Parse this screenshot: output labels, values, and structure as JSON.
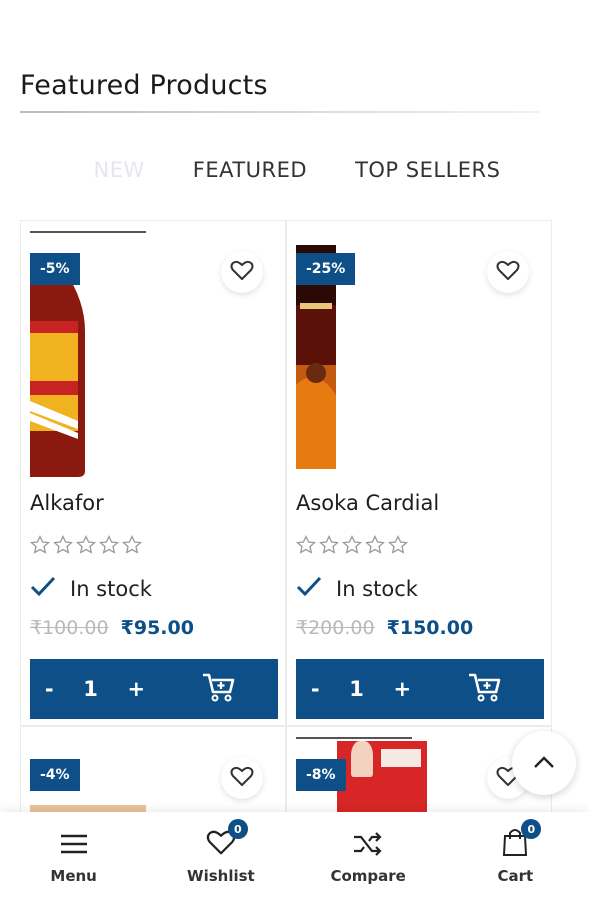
{
  "section": {
    "title": "Featured Products"
  },
  "tabs": [
    {
      "label": "NEW",
      "active": false
    },
    {
      "label": "FEATURED",
      "active": true
    },
    {
      "label": "TOP SELLERS",
      "active": true
    }
  ],
  "products": [
    {
      "name": "Alkafor",
      "discount": "-5%",
      "stock": "In stock",
      "old_price": "₹100.00",
      "new_price": "₹95.00",
      "qty": "1",
      "minus": "-",
      "plus": "+"
    },
    {
      "name": "Asoka Cardial",
      "discount": "-25%",
      "stock": "In stock",
      "old_price": "₹200.00",
      "new_price": "₹150.00",
      "qty": "1",
      "minus": "-",
      "plus": "+"
    },
    {
      "discount": "-4%"
    },
    {
      "discount": "-8%"
    }
  ],
  "nav": {
    "menu": "Menu",
    "wishlist": "Wishlist",
    "wishlist_count": "0",
    "compare": "Compare",
    "cart": "Cart",
    "cart_count": "0"
  },
  "colors": {
    "brand": "#0d4f86"
  },
  "icons": [
    "heart-icon",
    "star-icon",
    "check-icon",
    "cart-add-icon",
    "chevron-up-icon",
    "hamburger-icon",
    "shuffle-icon",
    "bag-icon"
  ]
}
